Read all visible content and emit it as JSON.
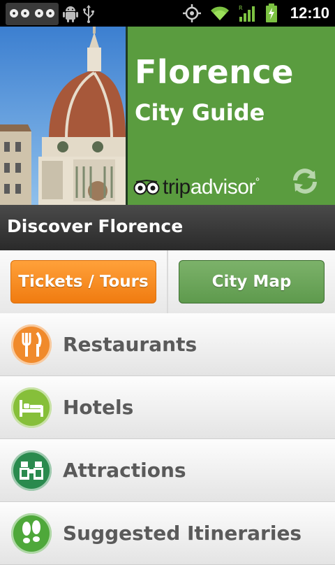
{
  "status_bar": {
    "time": "12:10"
  },
  "header": {
    "title": "Florence",
    "subtitle": "City Guide",
    "brand_part1": "trip",
    "brand_part2": "advisor",
    "brand_mark": "°"
  },
  "section": {
    "title": "Discover Florence"
  },
  "buttons": {
    "tickets_label": "Tickets / Tours",
    "map_label": "City Map"
  },
  "menu": [
    {
      "label": "Restaurants",
      "icon": "fork-knife-icon",
      "color": "#f08a2c"
    },
    {
      "label": "Hotels",
      "icon": "bed-icon",
      "color": "#86bf3a"
    },
    {
      "label": "Attractions",
      "icon": "binoculars-icon",
      "color": "#2a8a4e"
    },
    {
      "label": "Suggested Itineraries",
      "icon": "footprints-icon",
      "color": "#4ea83a"
    }
  ],
  "colors": {
    "hero_green": "#5a9c3f",
    "tickets_orange": "#f07b10",
    "map_green": "#5e9a4d"
  }
}
